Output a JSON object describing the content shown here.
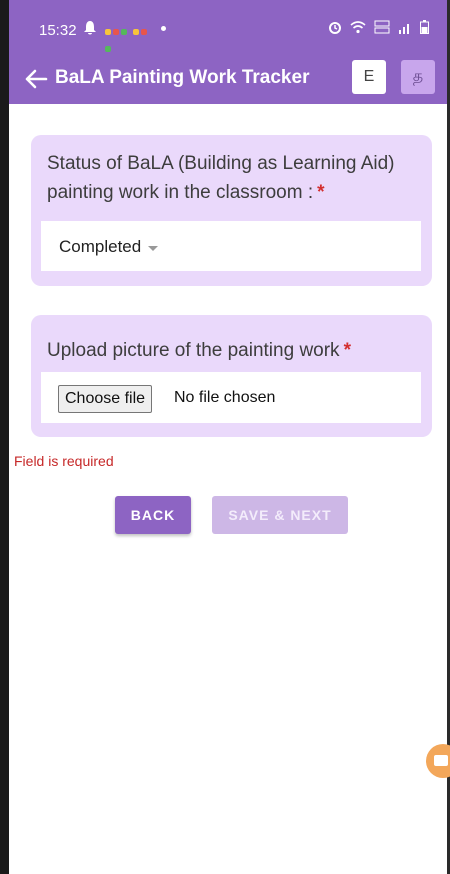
{
  "status_bar": {
    "time": "15:32",
    "notification_icon": "bell-icon",
    "right_icons": [
      "alarm-icon",
      "wifi-icon",
      "volte-icon",
      "signal-icon",
      "battery-icon"
    ]
  },
  "app_bar": {
    "title": "BaLA Painting Work Tracker",
    "lang_en": "E",
    "lang_ta": "த"
  },
  "form": {
    "status_question": {
      "label": "Status of BaLA (Building as Learning Aid) painting work in the classroom :",
      "required_mark": "*",
      "selected_value": "Completed"
    },
    "upload_question": {
      "label": "Upload picture of the painting work",
      "required_mark": "*",
      "choose_file_label": "Choose file",
      "file_status": "No file chosen"
    },
    "error_message": "Field is required"
  },
  "actions": {
    "back_label": "BACK",
    "save_next_label": "SAVE & NEXT"
  },
  "colors": {
    "primary": "#8d64c3",
    "card_bg": "#ead9fb",
    "error": "#c62828",
    "disabled_button": "#cdb7e6",
    "fab": "#f3a75a"
  }
}
